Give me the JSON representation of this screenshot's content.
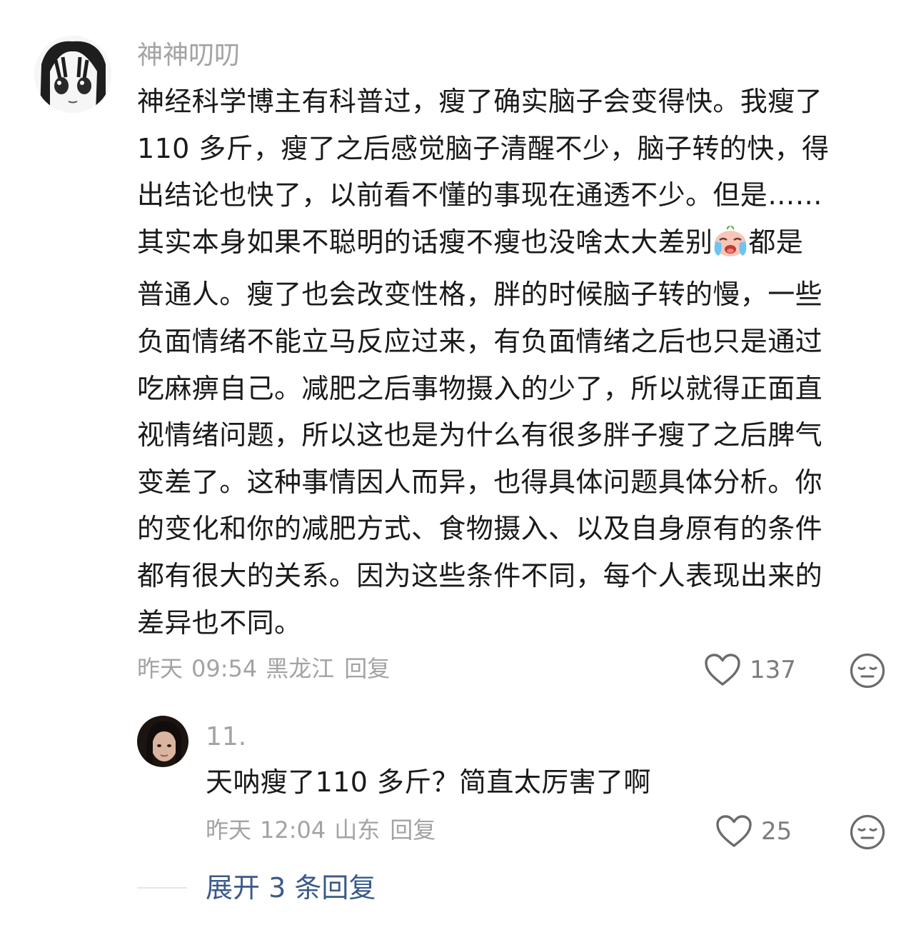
{
  "comment": {
    "username": "神神叨叨",
    "text_lines": [
      "神经科学博主有科普过，瘦了确实脑子会变得快。我瘦了",
      "110 多斤，瘦了之后感觉脑子清醒不少，脑子转的快，得",
      "出结论也快了，以前看不懂的事现在通透不少。但是……",
      "其实本身如果不聪明的话瘦不瘦也没啥太大差别",
      "都是",
      "普通人。瘦了也会改变性格，胖的时候脑子转的慢，一些",
      "负面情绪不能立马反应过来，有负面情绪之后也只是通过",
      "吃麻痹自己。减肥之后事物摄入的少了，所以就得正面直",
      "视情绪问题，所以这也是为什么有很多胖子瘦了之后脾气",
      "变差了。这种事情因人而异，也得具体问题具体分析。你",
      "的变化和你的减肥方式、食物摄入、以及自身原有的条件",
      "都有很大的关系。因为这些条件不同，每个人表现出来的",
      "差异也不同。"
    ],
    "emoji_icon": "crying-face-emoji",
    "date": "昨天",
    "time": "09:54",
    "location": "黑龙江",
    "reply_label": "回复",
    "like_count": "137"
  },
  "reply": {
    "username": "11.",
    "text": "天呐瘦了110 多斤？简直太厉害了啊",
    "date": "昨天",
    "time": "12:04",
    "location": "山东",
    "reply_label": "回复",
    "like_count": "25"
  },
  "expand": {
    "label": "展开 3 条回复"
  },
  "colors": {
    "text": "#1a1a1a",
    "meta": "#a3a3a3",
    "link": "#3a5a8a"
  },
  "icons": [
    "heart-outline-icon",
    "neutral-face-icon"
  ]
}
